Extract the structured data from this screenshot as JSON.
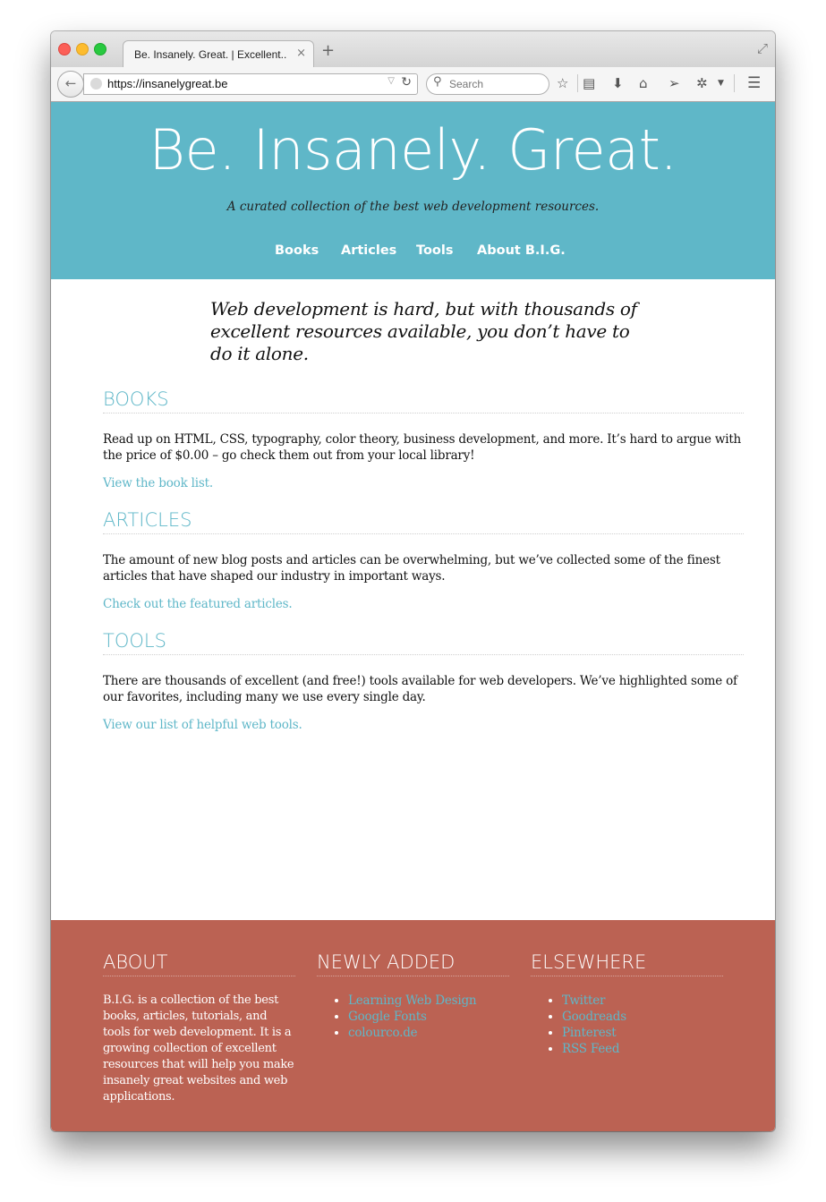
{
  "browser": {
    "tab_title": "Be. Insanely. Great. | Excellent...",
    "tab_close": "×",
    "new_tab": "+",
    "url": "https://insanelygreat.be",
    "search_placeholder": "Search",
    "icons": [
      "back-arrow-icon",
      "globe-icon",
      "reload-icon",
      "search-icon",
      "bookmark-star-icon",
      "reading-list-icon",
      "download-icon",
      "home-icon",
      "send-icon",
      "extension-icon",
      "menu-icon"
    ]
  },
  "site": {
    "title": "Be. Insanely. Great.",
    "tagline": "A curated collection of the best web development resources.",
    "nav": [
      "Books",
      "Articles",
      "Tools",
      "About B.I.G."
    ],
    "intro": "Web development is hard, but with thousands of excellent resources available, you don’t have to do it alone."
  },
  "sections": [
    {
      "heading": "BOOKS",
      "body": "Read up on HTML, CSS, typography, color theory, business development, and more. It’s hard to argue with the price of $0.00 – go check them out from your local library!",
      "link": "View the book list."
    },
    {
      "heading": "ARTICLES",
      "body": "The amount of new blog posts and articles can be overwhelming, but we’ve collected some of the finest articles that have shaped our industry in important ways.",
      "link": "Check out the featured articles."
    },
    {
      "heading": "TOOLS",
      "body": "There are thousands of excellent (and free!) tools available for web developers. We’ve highlighted some of our favorites, including many we use every single day.",
      "link": "View our list of helpful web tools."
    }
  ],
  "footer": {
    "about": {
      "heading": "ABOUT",
      "text": "B.I.G. is a collection of the best books, articles, tutorials, and tools for web development. It is a growing collection of excellent resources that will help you make insanely great websites and web applications."
    },
    "newly_added": {
      "heading": "NEWLY ADDED",
      "items": [
        "Learning Web Design",
        "Google Fonts",
        "colourco.de"
      ]
    },
    "elsewhere": {
      "heading": "ELSEWHERE",
      "items": [
        "Twitter",
        "Goodreads",
        "Pinterest",
        "RSS Feed"
      ]
    }
  },
  "colors": {
    "accent": "#5fb7c8",
    "footer_bg": "#bb6253",
    "text": "#111111"
  }
}
